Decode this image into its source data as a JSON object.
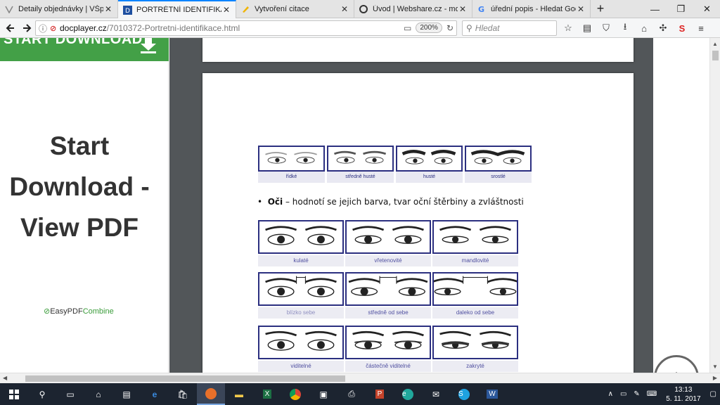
{
  "browser": {
    "tabs": [
      {
        "title": "Detaily objednávky | VŠpráce",
        "icon": "v-icon",
        "active": false
      },
      {
        "title": "PORTRÉTNÍ IDENTIFIKACE - Do",
        "icon": "docplayer-icon",
        "active": true
      },
      {
        "title": "Vytvoření citace",
        "icon": "pencil-icon",
        "active": false
      },
      {
        "title": "Úvod | Webshare.cz - moderní",
        "icon": "webshare-icon",
        "active": false
      },
      {
        "title": "úřední popis - Hledat Googlem",
        "icon": "google-icon",
        "active": false
      }
    ],
    "url_host": "docplayer.cz",
    "url_path": "/7010372-Portretni-identifikace.html",
    "zoom": "200%",
    "search_placeholder": "Hledat"
  },
  "sidebar": {
    "banner_label": "START DOWNLOAD",
    "title_line1": "Start",
    "title_line2": "Download -",
    "title_line3": "View PDF",
    "easypdf_a": "EasyPDF",
    "easypdf_b": "Combine",
    "accent_color": "#43a047"
  },
  "document": {
    "brow_captions": [
      "řídké",
      "středně husté",
      "husté",
      "srostlé"
    ],
    "bullet_bold": "Oči",
    "bullet_text": " – hodnotí se jejich barva, tvar oční štěrbiny a zvláštnosti",
    "eye_captions": [
      [
        "kulaté",
        "vřetenovité",
        "mandlovité"
      ],
      [
        "blízko sebe",
        "středně od sebe",
        "daleko od sebe"
      ],
      [
        "viditelné",
        "částečně viditelné",
        "zakryté"
      ]
    ],
    "frame_color": "#2b2f80"
  },
  "taskbar": {
    "time": "13:13",
    "date": "5. 11. 2017"
  }
}
